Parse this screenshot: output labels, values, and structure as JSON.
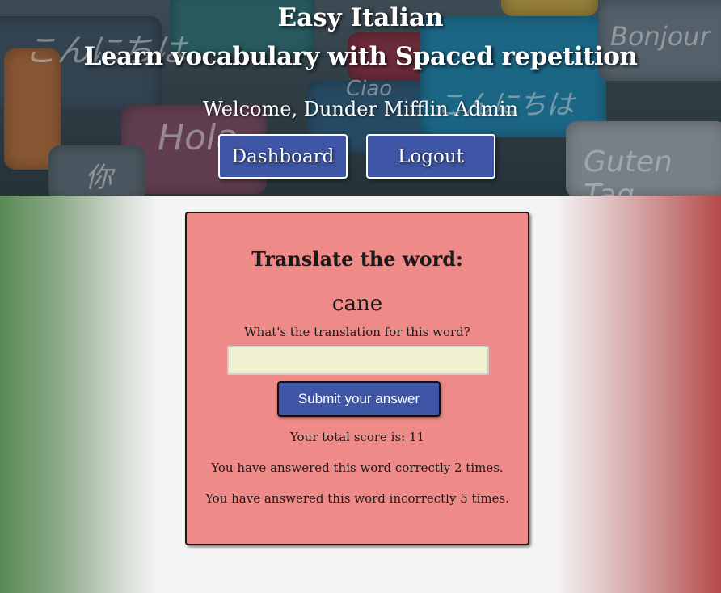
{
  "header": {
    "title_line1": "Easy Italian",
    "title_line2": "Learn vocabulary with Spaced repetition",
    "welcome": "Welcome, Dunder Mifflin Admin",
    "background_words": [
      "こんにちは",
      "Bonjour",
      "Hola",
      "Ciao",
      "你",
      "Guten Tag",
      "こんにちは"
    ]
  },
  "nav": {
    "dashboard_label": "Dashboard",
    "logout_label": "Logout"
  },
  "quiz": {
    "heading": "Translate the word:",
    "word": "cane",
    "prompt": "What's the translation for this word?",
    "input_value": "",
    "submit_label": "Submit your answer",
    "total_score_text": "Your total score is: 11",
    "correct_text": "You have answered this word correctly 2 times.",
    "incorrect_text": "You have answered this word incorrectly 5 times."
  },
  "colors": {
    "button_blue": "#3f56a6",
    "card_background": "#ee8a87",
    "input_background": "#f2f2d3",
    "flag_green": "#5a8a55",
    "flag_red": "#b44a48"
  }
}
